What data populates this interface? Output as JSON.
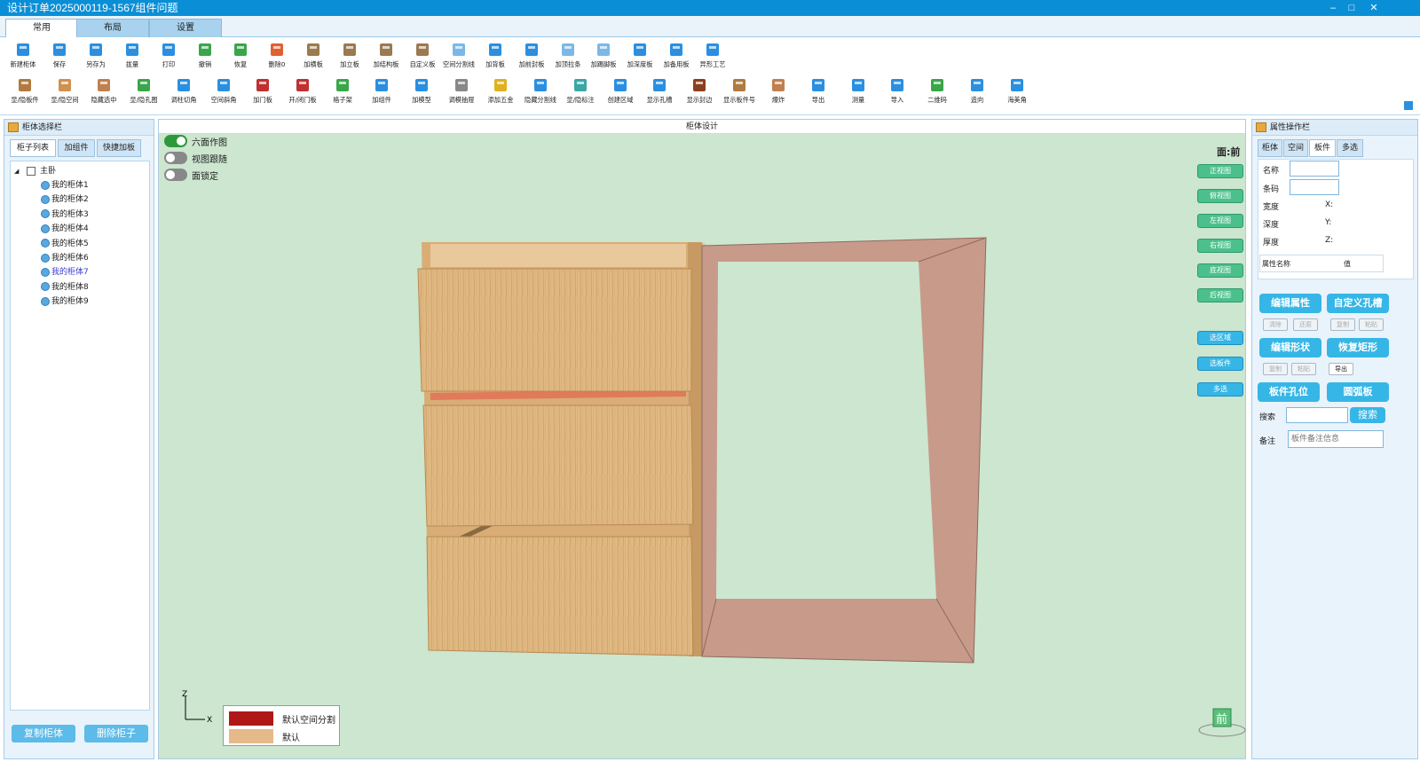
{
  "window": {
    "title": "设计订单2025000119-1567组件问题",
    "min": "–",
    "max": "□",
    "close": "✕"
  },
  "ribbon_tabs": [
    {
      "label": "常用"
    },
    {
      "label": "布局"
    },
    {
      "label": "设置"
    }
  ],
  "toolbar_row1": [
    {
      "label": "新建柜体",
      "icon": "new-cabinet-icon",
      "color": "#2a8fe0"
    },
    {
      "label": "保存",
      "icon": "save-icon",
      "color": "#2a8fe0"
    },
    {
      "label": "另存为",
      "icon": "save-as-icon",
      "color": "#2a8fe0"
    },
    {
      "label": "拢量",
      "icon": "collect-icon",
      "color": "#2a8fe0"
    },
    {
      "label": "打印",
      "icon": "print-icon",
      "color": "#2a8fe0"
    },
    {
      "label": "撤销",
      "icon": "undo-icon",
      "color": "#3aa64a"
    },
    {
      "label": "恢复",
      "icon": "redo-icon",
      "color": "#3aa64a"
    },
    {
      "label": "删除0",
      "icon": "delete-icon",
      "color": "#e06030"
    },
    {
      "label": "加横板",
      "icon": "add-horizontal-board-icon",
      "color": "#9b7a50"
    },
    {
      "label": "加立板",
      "icon": "add-vertical-board-icon",
      "color": "#9b7a50"
    },
    {
      "label": "加结构板",
      "icon": "add-structure-board-icon",
      "color": "#9b7a50"
    },
    {
      "label": "自定义板",
      "icon": "custom-board-icon",
      "color": "#9b7a50"
    },
    {
      "label": "空间分割线",
      "icon": "space-divider-icon",
      "color": "#7ab8e8"
    },
    {
      "label": "加背板",
      "icon": "add-back-board-icon",
      "color": "#2a8fe0"
    },
    {
      "label": "加前封板",
      "icon": "add-front-seal-icon",
      "color": "#2a8fe0"
    },
    {
      "label": "加顶拉条",
      "icon": "add-top-strip-icon",
      "color": "#7ab8e8"
    },
    {
      "label": "加踢脚板",
      "icon": "add-kickboard-icon",
      "color": "#7ab8e8"
    },
    {
      "label": "加深度板",
      "icon": "add-depth-board-icon",
      "color": "#2a8fe0"
    },
    {
      "label": "加备用板",
      "icon": "add-spare-board-icon",
      "color": "#2a8fe0"
    },
    {
      "label": "异形工艺",
      "icon": "special-shape-icon",
      "color": "#2a8fe0"
    }
  ],
  "toolbar_row2": [
    {
      "label": "显/隐板件",
      "icon": "toggle-board-icon",
      "color": "#b07a40"
    },
    {
      "label": "显/隐空间",
      "icon": "toggle-space-icon",
      "color": "#d09050"
    },
    {
      "label": "隐藏选中",
      "icon": "hide-selected-icon",
      "color": "#c08050"
    },
    {
      "label": "显/隐孔图",
      "icon": "toggle-hole-icon",
      "color": "#3aa64a"
    },
    {
      "label": "调柱切角",
      "icon": "column-cut-icon",
      "color": "#2a8fe0"
    },
    {
      "label": "空间斜角",
      "icon": "space-bevel-icon",
      "color": "#2a8fe0"
    },
    {
      "label": "加门板",
      "icon": "add-door-icon",
      "color": "#c03030"
    },
    {
      "label": "开/闭门板",
      "icon": "open-close-door-icon",
      "color": "#c03030"
    },
    {
      "label": "格子架",
      "icon": "grid-rack-icon",
      "color": "#3aa64a"
    },
    {
      "label": "加组件",
      "icon": "add-component-icon",
      "color": "#2a8fe0"
    },
    {
      "label": "加模型",
      "icon": "add-model-icon",
      "color": "#2a8fe0"
    },
    {
      "label": "调模抽屉",
      "icon": "drawer-icon",
      "color": "#888888"
    },
    {
      "label": "添加五金",
      "icon": "add-hardware-icon",
      "color": "#e0b020"
    },
    {
      "label": "隐藏分割线",
      "icon": "hide-divider-icon",
      "color": "#2a8fe0"
    },
    {
      "label": "显/隐标注",
      "icon": "toggle-dimension-icon",
      "color": "#3aa6a6"
    },
    {
      "label": "创建区域",
      "icon": "create-area-icon",
      "color": "#2a8fe0"
    },
    {
      "label": "显示孔槽",
      "icon": "show-slot-icon",
      "color": "#2a8fe0"
    },
    {
      "label": "显示封边",
      "icon": "show-edge-icon",
      "color": "#8a4020"
    },
    {
      "label": "显示板件号",
      "icon": "board-number-icon",
      "color": "#b07a40"
    },
    {
      "label": "爆炸",
      "icon": "explode-icon",
      "color": "#c08050"
    },
    {
      "label": "导出",
      "icon": "export-icon",
      "color": "#2a8fe0"
    },
    {
      "label": "测量",
      "icon": "measure-icon",
      "color": "#2a8fe0"
    },
    {
      "label": "导入",
      "icon": "import-icon",
      "color": "#2a8fe0"
    },
    {
      "label": "二维码",
      "icon": "qrcode-cloud-icon",
      "color": "#3aa64a"
    },
    {
      "label": "造向",
      "icon": "orientation-icon",
      "color": "#2a8fe0"
    },
    {
      "label": "海美角",
      "icon": "corner-icon",
      "color": "#2a8fe0"
    }
  ],
  "left_panel": {
    "title": "柜体选择栏",
    "tabs": [
      "柜子列表",
      "加组件",
      "快捷加板"
    ],
    "tree_root": "主卧",
    "tree_items": [
      "我的柜体1",
      "我的柜体2",
      "我的柜体3",
      "我的柜体4",
      "我的柜体5",
      "我的柜体6",
      "我的柜体7",
      "我的柜体8",
      "我的柜体9"
    ],
    "buttons": [
      "复制柜体",
      "删除柜子"
    ]
  },
  "center": {
    "title": "柜体设计",
    "toggles": [
      {
        "label": "六面作图",
        "on": true
      },
      {
        "label": "视图跟随",
        "on": false
      },
      {
        "label": "面锁定",
        "on": false
      }
    ],
    "face_label": "面:前",
    "view_buttons": [
      "正视图",
      "俯视图",
      "左视图",
      "右视图",
      "底视图",
      "后视图"
    ],
    "select_buttons": [
      "选区域",
      "选板件",
      "多选"
    ],
    "legend": [
      {
        "label": "默认空间分割",
        "color": "#b01818"
      },
      {
        "label": "默认",
        "color": "#e6b98a"
      }
    ],
    "axis_z": "Z",
    "axis_x": "X",
    "cube_face": "前"
  },
  "right_panel": {
    "title": "属性操作栏",
    "tabs": [
      "柜体",
      "空间",
      "板件",
      "多选"
    ],
    "fields": {
      "name": "名称",
      "code": "条码",
      "width": "宽度",
      "depth": "深度",
      "thickness": "厚度"
    },
    "coords": {
      "x": "X:",
      "y": "Y:",
      "z": "Z:"
    },
    "table_headers": [
      "属性名称",
      "值"
    ],
    "btn_edit_attr": "编辑属性",
    "btn_custom_hole": "自定义孔槽",
    "small_row1": [
      "清除",
      "还原",
      "复制",
      "粘贴"
    ],
    "btn_edit_shape": "编辑形状",
    "btn_restore_rect": "恢复矩形",
    "small_row2": [
      "复制",
      "粘贴",
      "导出"
    ],
    "btn_board_hole": "板件孔位",
    "btn_arc_board": "圆弧板",
    "search_label": "搜索",
    "search_button": "搜索",
    "note_label": "备注",
    "note_placeholder": "板件备注信息"
  }
}
